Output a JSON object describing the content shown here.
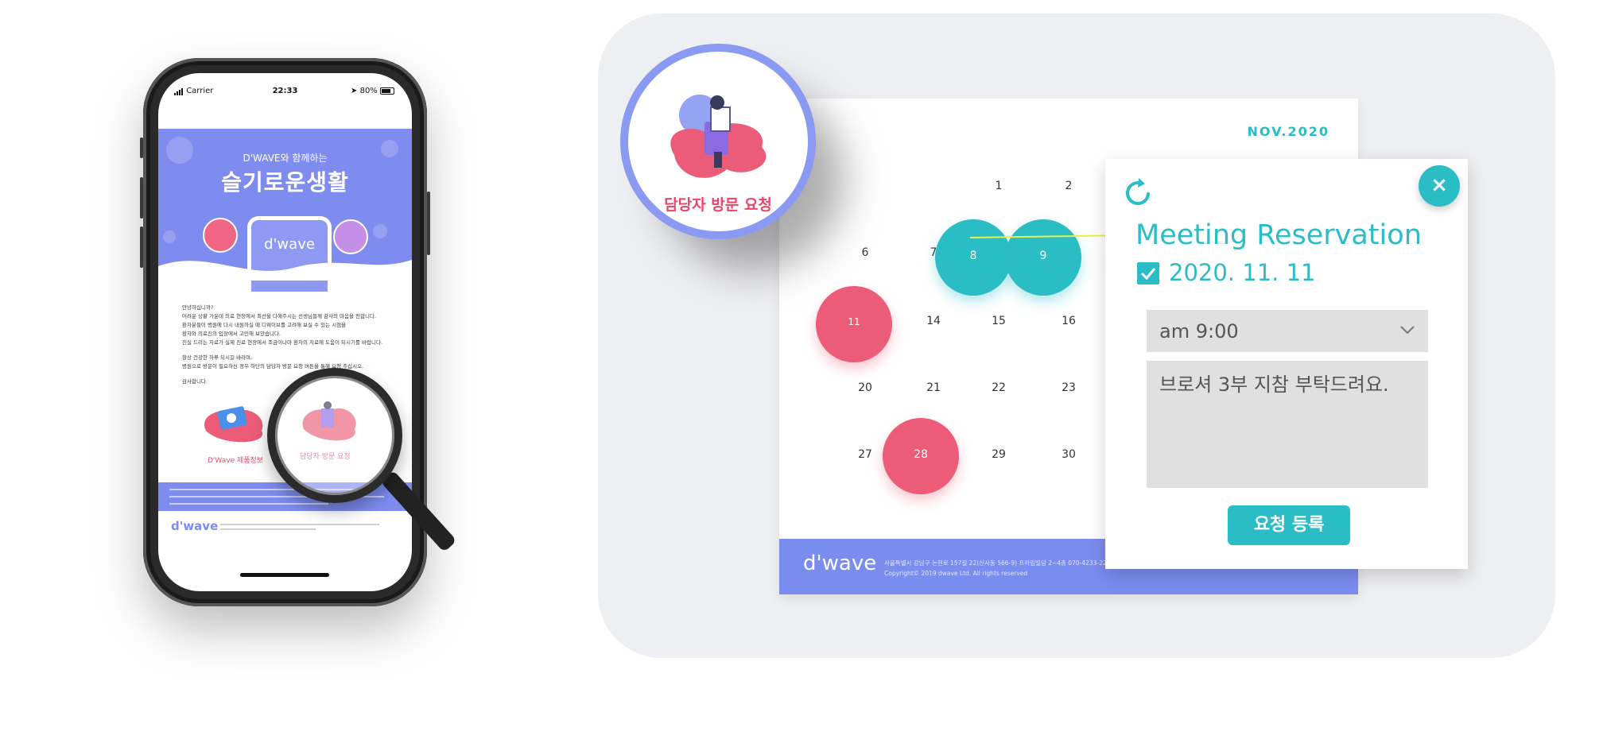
{
  "phone": {
    "status": {
      "carrier": "Carrier",
      "time": "22:33",
      "battery": "80%"
    },
    "hero": {
      "subtitle": "D'WAVE와 함께하는",
      "title": "슬기로운생활",
      "logo": "d'wave"
    },
    "letter": {
      "paragraphs": [
        "안녕하십니까?\n어려운 상황 가운데 의료 현장에서 최선을 다해주시는 선생님들께 감사의 마음을 전합니다.\n환자분들이 병원에 다시 내원하실 때 디웨이브를 고려해 보실 수 있는 시점을\n환자와 의료진의 입장에서 고민해 보았습니다.\n진실 드리는 자료가 실제 진료 현장에서 조금이나마 환자의 치료에 도움이 되시기를 바랍니다.",
        "항상 건강한 하루 되시길 바라며,\n병원으로 방문이 필요하신 경우 하단의 담당자 방문 요청 버튼을 통해 요청 주십시오.",
        "감사합니다."
      ]
    },
    "links": {
      "product_info": "D'Wave 제품정보",
      "visit_request": "담당자 방문 요청"
    },
    "footer": {
      "logo": "d'wave"
    }
  },
  "request_badge": {
    "label": "담당자 방문 요청"
  },
  "calendar": {
    "month": "NOV.2020",
    "days": [
      {
        "label": "1"
      },
      {
        "label": "2"
      },
      {
        "label": "6"
      },
      {
        "label": "7"
      },
      {
        "label": "14"
      },
      {
        "label": "15"
      },
      {
        "label": "16"
      },
      {
        "label": "20"
      },
      {
        "label": "21"
      },
      {
        "label": "22"
      },
      {
        "label": "23"
      },
      {
        "label": "27"
      },
      {
        "label": "29"
      },
      {
        "label": "30"
      }
    ],
    "highlighted": [
      {
        "label": "8",
        "status": "booked"
      },
      {
        "label": "9",
        "status": "booked"
      },
      {
        "label": "11",
        "status": "selected"
      },
      {
        "label": "28",
        "status": "selected"
      }
    ],
    "footer": {
      "logo": "d'wave",
      "address": "서울특별시 강남구 논현로 157길 22(신사동 566-9) 프라임빌딩 2~4층     070-4233-2256     Email",
      "copyright": "Copyright© 2019 dwave Ltd. All rights reserved"
    }
  },
  "reservation": {
    "title": "Meeting Reservation",
    "date": "2020. 11. 11",
    "date_checked": true,
    "time_value": "am 9:00",
    "memo": "브로셔 3부 지참 부탁드려요.",
    "submit_label": "요청 등록",
    "close_label": "×"
  },
  "colors": {
    "brand_purple": "#7b8cef",
    "teal": "#2bbdc6",
    "pink": "#ec5c78",
    "panel_bg": "#eeeff2"
  },
  "icons": [
    "refresh-icon",
    "close-icon",
    "check-icon",
    "chevron-down-icon",
    "magnifier-icon"
  ]
}
